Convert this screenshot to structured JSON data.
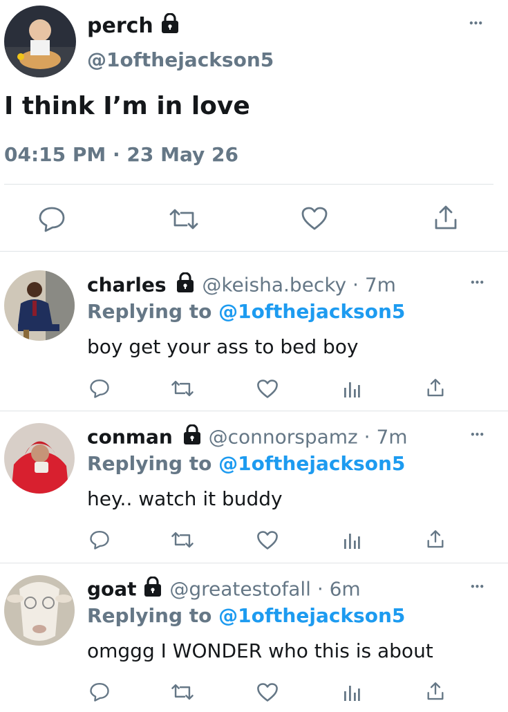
{
  "main_tweet": {
    "display_name": "perch",
    "handle": "@1ofthejackson5",
    "text": "I think I’m in love",
    "timestamp": "04:15 PM · 23 May 26",
    "more": "•••"
  },
  "replies": [
    {
      "display_name": "charles",
      "handle": "@keisha.becky",
      "time": "· 7m",
      "replying_prefix": "Replying to",
      "replying_handle": "@1ofthejackson5",
      "text": "boy get your ass to bed boy",
      "more": "•••"
    },
    {
      "display_name": "conman",
      "handle": "@connorspamz",
      "time": "· 7m",
      "replying_prefix": "Replying to",
      "replying_handle": "@1ofthejackson5",
      "text": "hey.. watch it buddy",
      "more": "•••"
    },
    {
      "display_name": "goat",
      "handle": "@greatestofall",
      "time": "· 6m",
      "replying_prefix": "Replying to",
      "replying_handle": "@1ofthejackson5",
      "text": "omggg I WONDER who this is about",
      "more": "•••"
    }
  ],
  "colors": {
    "link": "#1d9bf0",
    "muted": "#657786",
    "text": "#14171a",
    "divider": "#dfe3e6"
  },
  "icons": [
    "reply-icon",
    "retweet-icon",
    "like-icon",
    "analytics-icon",
    "share-icon",
    "lock-icon",
    "more-icon"
  ]
}
